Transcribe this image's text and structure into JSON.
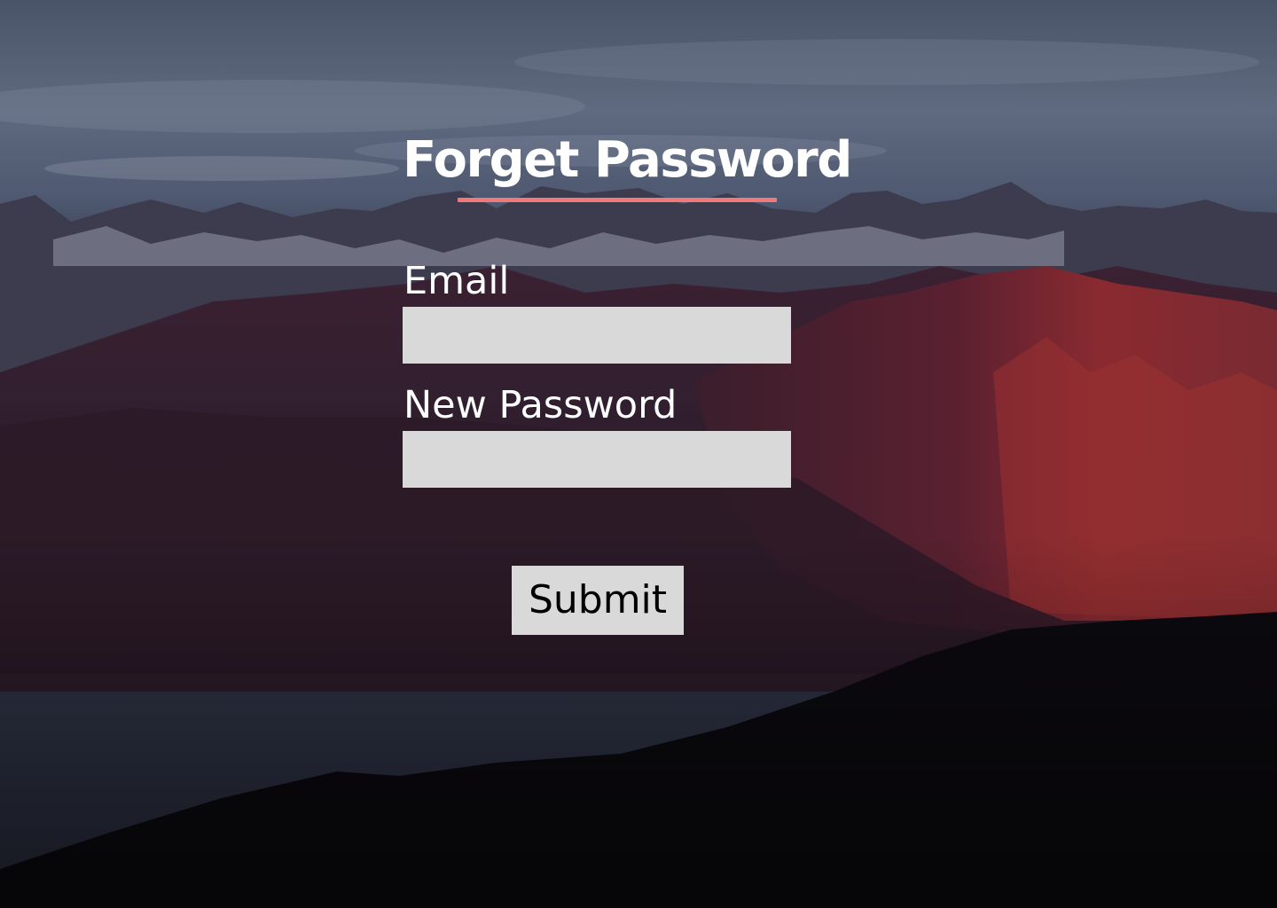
{
  "page": {
    "title": "Forget Password",
    "accent_color": "#f07a7a"
  },
  "form": {
    "email_label": "Email",
    "email_value": "",
    "password_label": "New Password",
    "password_value": "",
    "submit_label": "Submit"
  },
  "background": {
    "image": "mountain-landscape-dusk"
  },
  "colors": {
    "field_background": "#d9d9d9",
    "text": "#ffffff",
    "button_text": "#000000"
  }
}
